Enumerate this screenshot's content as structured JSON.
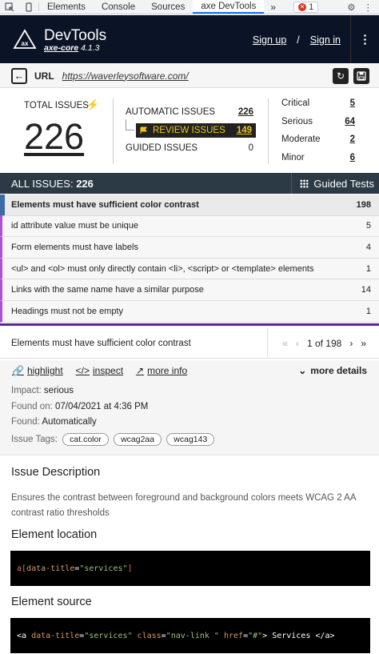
{
  "devtools_tabs": {
    "tabs": [
      "Elements",
      "Console",
      "Sources",
      "axe DevTools"
    ],
    "active": "axe DevTools",
    "more": "»",
    "error_count": "1"
  },
  "header": {
    "title": "DevTools",
    "engine": "axe-core",
    "version": "4.1.3",
    "sign_up": "Sign up",
    "separator": "/",
    "sign_in": "Sign in"
  },
  "urlbar": {
    "label": "URL",
    "value": "https://waverleysoftware.com/"
  },
  "summary": {
    "total_label": "TOTAL ISSUES",
    "total": "226",
    "automatic_label": "AUTOMATIC ISSUES",
    "automatic": "226",
    "review_label": "REVIEW ISSUES",
    "review": "149",
    "guided_label": "GUIDED ISSUES",
    "guided": "0",
    "severity": [
      {
        "label": "Critical",
        "count": "5"
      },
      {
        "label": "Serious",
        "count": "64"
      },
      {
        "label": "Moderate",
        "count": "2"
      },
      {
        "label": "Minor",
        "count": "6"
      }
    ]
  },
  "all_issues": {
    "label": "ALL ISSUES:",
    "count": "226",
    "guided_tests": "Guided Tests"
  },
  "issues": [
    {
      "name": "Elements must have sufficient color contrast",
      "count": "198"
    },
    {
      "name": "id attribute value must be unique",
      "count": "5"
    },
    {
      "name": "Form elements must have labels",
      "count": "4"
    },
    {
      "name": "<ul> and <ol> must only directly contain <li>, <script> or <template> elements",
      "count": "1"
    },
    {
      "name": "Links with the same name have a similar purpose",
      "count": "14"
    },
    {
      "name": "Headings must not be empty",
      "count": "1"
    }
  ],
  "detail": {
    "title": "Elements must have sufficient color contrast",
    "pager_text": "1 of 198",
    "actions": {
      "highlight": "highlight",
      "inspect": "inspect",
      "more_info": "more info",
      "more_details": "more details"
    },
    "impact_label": "Impact:",
    "impact": "serious",
    "found_on_label": "Found on:",
    "found_on": "07/04/2021 at 4:36 PM",
    "found_label": "Found:",
    "found": "Automatically",
    "tags_label": "Issue Tags:",
    "tags": [
      "cat.color",
      "wcag2aa",
      "wcag143"
    ],
    "description_heading": "Issue Description",
    "description": "Ensures the contrast between foreground and background colors meets WCAG 2 AA contrast ratio thresholds",
    "location_heading": "Element location",
    "location_code": {
      "tag": "a",
      "attr": "data-title",
      "value": "\"services\"",
      "close": "]"
    },
    "source_heading": "Element source",
    "source_code": {
      "open": "<a ",
      "attr1": "data-title",
      "val1": "\"services\"",
      "attr2": "class",
      "val2": "\"nav-link \"",
      "attr3": "href",
      "val3": "\"#\"",
      "gt": ">",
      "text": " Services ",
      "close": "</a>"
    }
  },
  "colors": {
    "header_bg": "#0b1426",
    "issues_bar_bg": "#2b3a45",
    "review_bg": "#222222",
    "review_fg": "#f0c419",
    "issue_accent": "#b04fd3",
    "selected_accent": "#3d6ba3"
  }
}
